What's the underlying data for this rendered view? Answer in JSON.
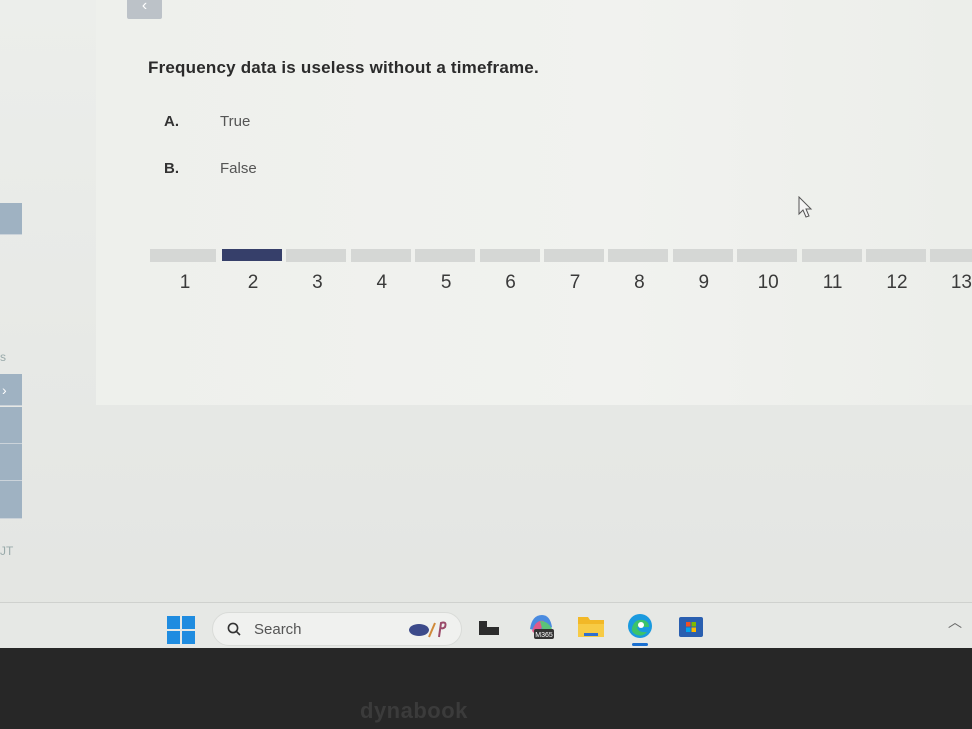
{
  "quiz": {
    "question": "Frequency data is useless without a timeframe.",
    "options": [
      {
        "letter": "A.",
        "text": "True"
      },
      {
        "letter": "B.",
        "text": "False"
      }
    ],
    "current_question": 2,
    "question_numbers": [
      "1",
      "2",
      "3",
      "4",
      "5",
      "6",
      "7",
      "8",
      "9",
      "10",
      "11",
      "12",
      "13"
    ],
    "active_color": "#363f6a"
  },
  "nav": {
    "back_icon": "chevron-left-icon"
  },
  "sidebar": {
    "texts": [
      "s",
      "JT"
    ],
    "arrow_icon": "chevron-right-icon"
  },
  "taskbar": {
    "search_placeholder": "Search",
    "apps": [
      {
        "name": "task-view-app-icon"
      },
      {
        "name": "microsoft-365-app-icon",
        "label": "M365"
      },
      {
        "name": "file-explorer-app-icon"
      },
      {
        "name": "edge-browser-app-icon"
      },
      {
        "name": "microsoft-store-app-icon"
      }
    ],
    "tray_icon": "chevron-up-icon"
  },
  "device": {
    "brand": "dynabook"
  }
}
